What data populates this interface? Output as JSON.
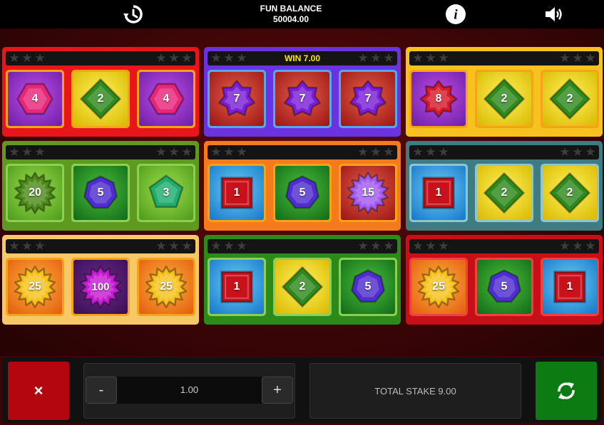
{
  "header": {
    "balance_label": "FUN BALANCE",
    "balance_value": "50004.00",
    "icons": [
      "history-icon",
      "info-icon",
      "sound-icon"
    ]
  },
  "cards": [
    {
      "frame": "#e8161a",
      "tile_border": "#f6a319",
      "win": "",
      "tiles": [
        {
          "shape": "hexagon",
          "color": "#e8277a",
          "bg": "purple",
          "value": "4"
        },
        {
          "shape": "diamond",
          "color": "#2f8a1e",
          "bg": "yellow",
          "value": "2"
        },
        {
          "shape": "hexagon",
          "color": "#e8277a",
          "bg": "purple",
          "value": "4"
        }
      ]
    },
    {
      "frame": "#6a32e0",
      "tile_border": "#56a8ea",
      "win": "WIN 7.00",
      "tiles": [
        {
          "shape": "star7",
          "color": "#7a1fd6",
          "bg": "red",
          "value": "7"
        },
        {
          "shape": "star7",
          "color": "#7a1fd6",
          "bg": "red",
          "value": "7"
        },
        {
          "shape": "star7",
          "color": "#7a1fd6",
          "bg": "red",
          "value": "7"
        }
      ]
    },
    {
      "frame": "#f7c21e",
      "tile_border": "#f6a319",
      "win": "",
      "tiles": [
        {
          "shape": "star8",
          "color": "#d61a2a",
          "bg": "purple",
          "value": "8"
        },
        {
          "shape": "diamond",
          "color": "#2f8a1e",
          "bg": "yellow",
          "value": "2"
        },
        {
          "shape": "diamond",
          "color": "#2f8a1e",
          "bg": "yellow",
          "value": "2"
        }
      ]
    },
    {
      "frame": "#5e9a1f",
      "tile_border": "#8ccf52",
      "win": "",
      "tiles": [
        {
          "shape": "burst",
          "color": "#4e8a1c",
          "bg": "lightgreen",
          "value": "20"
        },
        {
          "shape": "heptagon",
          "color": "#4f2ed0",
          "bg": "green",
          "value": "5"
        },
        {
          "shape": "pentagon",
          "color": "#1fae6d",
          "bg": "lightgreen",
          "value": "3"
        }
      ]
    },
    {
      "frame": "#f47a1c",
      "tile_border": "#f6a319",
      "win": "",
      "tiles": [
        {
          "shape": "square",
          "color": "#c8111b",
          "bg": "blue",
          "value": "1"
        },
        {
          "shape": "heptagon",
          "color": "#4f2ed0",
          "bg": "green",
          "value": "5"
        },
        {
          "shape": "burst",
          "color": "#a35cf0",
          "bg": "red",
          "value": "15"
        }
      ]
    },
    {
      "frame": "#3e7b83",
      "tile_border": "#8fc5cf",
      "win": "",
      "tiles": [
        {
          "shape": "square",
          "color": "#c8111b",
          "bg": "blue",
          "value": "1"
        },
        {
          "shape": "diamond",
          "color": "#2f8a1e",
          "bg": "yellow",
          "value": "2"
        },
        {
          "shape": "diamond",
          "color": "#2f8a1e",
          "bg": "yellow",
          "value": "2"
        }
      ]
    },
    {
      "frame": "#f6c867",
      "tile_border": "#f6a319",
      "win": "",
      "tiles": [
        {
          "shape": "burst",
          "color": "#f7c21e",
          "bg": "orange",
          "value": "25"
        },
        {
          "shape": "burst",
          "color": "#c61cd4",
          "bg": "darkpurple",
          "value": "100"
        },
        {
          "shape": "burst",
          "color": "#f7c21e",
          "bg": "orange",
          "value": "25"
        }
      ]
    },
    {
      "frame": "#2b8a1a",
      "tile_border": "#8ccf52",
      "win": "",
      "tiles": [
        {
          "shape": "square",
          "color": "#c8111b",
          "bg": "blue",
          "value": "1"
        },
        {
          "shape": "diamond",
          "color": "#2f8a1e",
          "bg": "yellow",
          "value": "2"
        },
        {
          "shape": "heptagon",
          "color": "#4f2ed0",
          "bg": "green",
          "value": "5"
        }
      ]
    },
    {
      "frame": "#c60f16",
      "tile_border": "#f04040",
      "win": "",
      "tiles": [
        {
          "shape": "burst",
          "color": "#f7c21e",
          "bg": "orange",
          "value": "25"
        },
        {
          "shape": "heptagon",
          "color": "#4f2ed0",
          "bg": "green",
          "value": "5"
        },
        {
          "shape": "square",
          "color": "#c8111b",
          "bg": "blue",
          "value": "1"
        }
      ]
    }
  ],
  "footer": {
    "close_label": "×",
    "minus_label": "-",
    "plus_label": "+",
    "stake_value": "1.00",
    "total_stake": "TOTAL STAKE 9.00",
    "spin_icon": "refresh-icon"
  }
}
